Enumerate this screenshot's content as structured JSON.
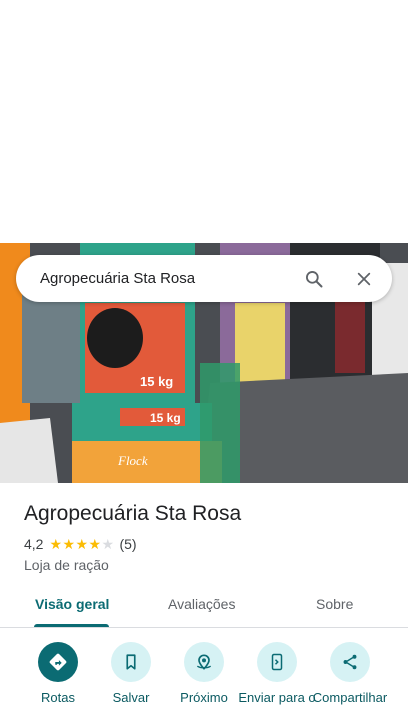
{
  "search": {
    "query": "Agropecuária Sta Rosa"
  },
  "place": {
    "name": "Agropecuária Sta Rosa",
    "rating": "4,2",
    "rating_value": 4.2,
    "review_count": "(5)",
    "category": "Loja de ração"
  },
  "photo": {
    "bag_weight_1": "15 kg",
    "bag_weight_2": "15 kg",
    "bag_brand": "Flock"
  },
  "tabs": [
    {
      "label": "Visão geral",
      "active": true
    },
    {
      "label": "Avaliações",
      "active": false
    },
    {
      "label": "Sobre",
      "active": false
    }
  ],
  "actions": [
    {
      "label": "Rotas",
      "icon": "directions-icon"
    },
    {
      "label": "Salvar",
      "icon": "bookmark-icon"
    },
    {
      "label": "Próximo",
      "icon": "nearby-icon"
    },
    {
      "label": "Enviar para o",
      "icon": "send-to-phone-icon"
    },
    {
      "label": "Compartilhar",
      "icon": "share-icon"
    }
  ],
  "colors": {
    "accent": "#0b6b73",
    "accent_light": "#d6f2f4",
    "star": "#fbbc04"
  }
}
